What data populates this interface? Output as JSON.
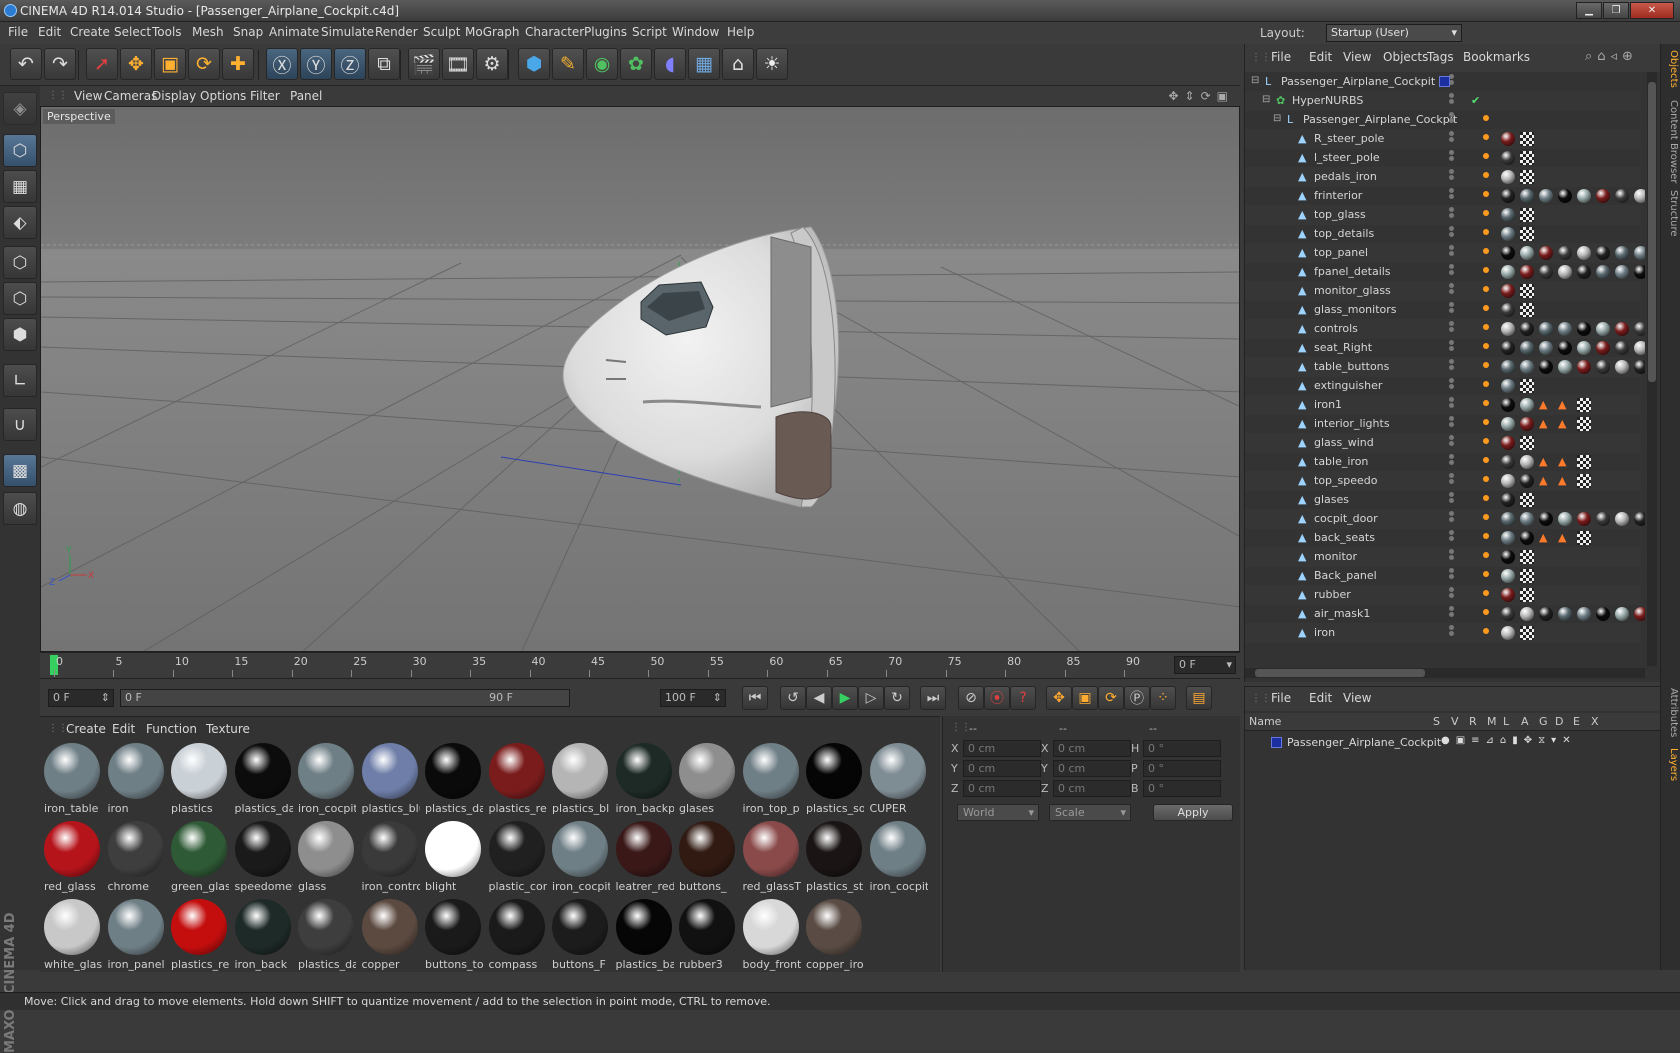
{
  "window": {
    "title": "CINEMA 4D R14.014 Studio - [Passenger_Airplane_Cockpit.c4d]"
  },
  "menubar": [
    "File",
    "Edit",
    "Create",
    "Select",
    "Tools",
    "Mesh",
    "Snap",
    "Animate",
    "Simulate",
    "Render",
    "Sculpt",
    "MoGraph",
    "Character",
    "Plugins",
    "Script",
    "Window",
    "Help"
  ],
  "layout": {
    "label": "Layout:",
    "value": "Startup (User)"
  },
  "toolbar_icons": [
    "undo-icon",
    "redo-icon",
    "select-icon",
    "move-icon",
    "scale-icon",
    "rotate-icon",
    "add-icon",
    "x-axis-icon",
    "y-axis-icon",
    "z-axis-icon",
    "coordinate-system-icon",
    "render-view-icon",
    "render-picture-queue-icon",
    "render-settings-icon",
    "cube-icon",
    "spline-pen-icon",
    "nurbs-icon",
    "array-icon",
    "deformer-icon",
    "floor-icon",
    "camera-icon",
    "light-icon"
  ],
  "viewport": {
    "menu": [
      "View",
      "Cameras",
      "Display",
      "Options",
      "Filter",
      "Panel"
    ],
    "label": "Perspective",
    "axes": {
      "x": "X",
      "y": "Y",
      "z": "Z"
    }
  },
  "timeline": {
    "ticks": [
      "0",
      "5",
      "10",
      "15",
      "20",
      "25",
      "30",
      "35",
      "40",
      "45",
      "50",
      "55",
      "60",
      "65",
      "70",
      "75",
      "80",
      "85",
      "90"
    ],
    "current_frame": "0 F"
  },
  "transport": {
    "start": "0 F",
    "range_start": "0 F",
    "range_end": "90 F",
    "end": "100 F"
  },
  "materials": {
    "menu": [
      "Create",
      "Edit",
      "Function",
      "Texture"
    ],
    "items": [
      {
        "name": "iron_table",
        "color": "#6f7f86"
      },
      {
        "name": "iron",
        "color": "#6f7f86"
      },
      {
        "name": "plastics",
        "color": "#c9d0d6"
      },
      {
        "name": "plastics_da",
        "color": "#0c0c0c"
      },
      {
        "name": "iron_cocpit",
        "color": "#6f7f86"
      },
      {
        "name": "plastics_blu",
        "color": "#6e7ea8"
      },
      {
        "name": "plastics_da",
        "color": "#0a0a0a"
      },
      {
        "name": "plastics_rec",
        "color": "#7a1c1c"
      },
      {
        "name": "plastics_blu",
        "color": "#b5b5b5"
      },
      {
        "name": "iron_backp",
        "color": "#1d2a26"
      },
      {
        "name": "glases",
        "color": "#8e8e8e"
      },
      {
        "name": "iron_top_p",
        "color": "#6f7f86"
      },
      {
        "name": "plastics_sof",
        "color": "#050505"
      },
      {
        "name": "CUPER",
        "color": "#7e8c93"
      },
      {
        "name": "red_glass",
        "color": "#b5141b"
      },
      {
        "name": "chrome",
        "color": "#3e3e3e"
      },
      {
        "name": "green_glas",
        "color": "#2f5a36"
      },
      {
        "name": "speedomet",
        "color": "#1a1a1a"
      },
      {
        "name": "glass",
        "color": "#8e8e8e"
      },
      {
        "name": "iron_contro",
        "color": "#3a3a3a"
      },
      {
        "name": "blight",
        "color": "#ffffff"
      },
      {
        "name": "plastic_con",
        "color": "#202020"
      },
      {
        "name": "iron_cocpit",
        "color": "#6f7f86"
      },
      {
        "name": "leatrer_red",
        "color": "#3a1818"
      },
      {
        "name": "buttons_",
        "color": "#301a12"
      },
      {
        "name": "red_glassT",
        "color": "#8a4a4a"
      },
      {
        "name": "plastics_ste",
        "color": "#1a1414"
      },
      {
        "name": "iron_cocpit",
        "color": "#6f7f86"
      },
      {
        "name": "white_glas",
        "color": "#c8c8c8"
      },
      {
        "name": "iron_panel",
        "color": "#6f7f86"
      },
      {
        "name": "plastics_rec",
        "color": "#c40e0e"
      },
      {
        "name": "iron_back",
        "color": "#1e2a28"
      },
      {
        "name": "plastics_da",
        "color": "#3e3e3e"
      },
      {
        "name": "copper",
        "color": "#5c4a40"
      },
      {
        "name": "buttons_to",
        "color": "#1a1a1a"
      },
      {
        "name": "compass",
        "color": "#1a1a1a"
      },
      {
        "name": "buttons_F",
        "color": "#1c1c1c"
      },
      {
        "name": "plastics_ba",
        "color": "#060606"
      },
      {
        "name": "rubber3",
        "color": "#111111"
      },
      {
        "name": "body_front",
        "color": "#d8d8d8"
      },
      {
        "name": "copper_iro",
        "color": "#5a4c44"
      }
    ]
  },
  "coordinates": {
    "headers": [
      "--",
      "--",
      "--"
    ],
    "rows": [
      {
        "a": "X",
        "av": "0 cm",
        "b": "X",
        "bv": "0 cm",
        "c": "H",
        "cv": "0 °"
      },
      {
        "a": "Y",
        "av": "0 cm",
        "b": "Y",
        "bv": "0 cm",
        "c": "P",
        "cv": "0 °"
      },
      {
        "a": "Z",
        "av": "0 cm",
        "b": "Z",
        "bv": "0 cm",
        "c": "B",
        "cv": "0 °"
      }
    ],
    "mode": "World",
    "type": "Scale",
    "apply": "Apply"
  },
  "objects": {
    "menu": [
      "File",
      "Edit",
      "View",
      "Objects",
      "Tags",
      "Bookmarks"
    ],
    "items": [
      {
        "name": "Passenger_Airplane_Cockpit",
        "level": 0,
        "icon": "null-icon"
      },
      {
        "name": "HyperNURBS",
        "level": 1,
        "icon": "hypernurbs-icon"
      },
      {
        "name": "Passenger_Airplane_Cockpit",
        "level": 2,
        "icon": "null-icon"
      },
      {
        "name": "R_steer_pole",
        "level": 3,
        "icon": "polygon-icon"
      },
      {
        "name": "l_steer_pole",
        "level": 3,
        "icon": "polygon-icon"
      },
      {
        "name": "pedals_iron",
        "level": 3,
        "icon": "polygon-icon"
      },
      {
        "name": "frinterior",
        "level": 3,
        "icon": "polygon-icon"
      },
      {
        "name": "top_glass",
        "level": 3,
        "icon": "polygon-icon"
      },
      {
        "name": "top_details",
        "level": 3,
        "icon": "polygon-icon"
      },
      {
        "name": "top_panel",
        "level": 3,
        "icon": "polygon-icon"
      },
      {
        "name": "fpanel_details",
        "level": 3,
        "icon": "polygon-icon"
      },
      {
        "name": "monitor_glass",
        "level": 3,
        "icon": "polygon-icon"
      },
      {
        "name": "glass_monitors",
        "level": 3,
        "icon": "polygon-icon"
      },
      {
        "name": "controls",
        "level": 3,
        "icon": "polygon-icon"
      },
      {
        "name": "seat_Right",
        "level": 3,
        "icon": "polygon-icon"
      },
      {
        "name": "table_buttons",
        "level": 3,
        "icon": "polygon-icon"
      },
      {
        "name": "extinguisher",
        "level": 3,
        "icon": "polygon-icon"
      },
      {
        "name": "iron1",
        "level": 3,
        "icon": "polygon-icon"
      },
      {
        "name": "interior_lights",
        "level": 3,
        "icon": "polygon-icon"
      },
      {
        "name": "glass_wind",
        "level": 3,
        "icon": "polygon-icon"
      },
      {
        "name": "table_iron",
        "level": 3,
        "icon": "polygon-icon"
      },
      {
        "name": "top_speedo",
        "level": 3,
        "icon": "polygon-icon"
      },
      {
        "name": "glases",
        "level": 3,
        "icon": "polygon-icon"
      },
      {
        "name": "cocpit_door",
        "level": 3,
        "icon": "polygon-icon"
      },
      {
        "name": "back_seats",
        "level": 3,
        "icon": "polygon-icon"
      },
      {
        "name": "monitor",
        "level": 3,
        "icon": "polygon-icon"
      },
      {
        "name": "Back_panel",
        "level": 3,
        "icon": "polygon-icon"
      },
      {
        "name": "rubber",
        "level": 3,
        "icon": "polygon-icon"
      },
      {
        "name": "air_mask1",
        "level": 3,
        "icon": "polygon-icon"
      },
      {
        "name": "iron",
        "level": 3,
        "icon": "polygon-icon"
      }
    ]
  },
  "layers": {
    "menu": [
      "File",
      "Edit",
      "View"
    ],
    "columns": [
      "Name",
      "S",
      "V",
      "R",
      "M",
      "L",
      "A",
      "G",
      "D",
      "E",
      "X"
    ],
    "items": [
      {
        "name": "Passenger_Airplane_Cockpit",
        "color": "#1b2fa0"
      }
    ]
  },
  "right_tabs": [
    "Objects",
    "Content Browser",
    "Structure",
    "Attributes",
    "Layers"
  ],
  "status": "Move: Click and drag to move elements. Hold down SHIFT to quantize movement / add to the selection in point mode, CTRL to remove.",
  "brand": "MAXON CINEMA 4D"
}
